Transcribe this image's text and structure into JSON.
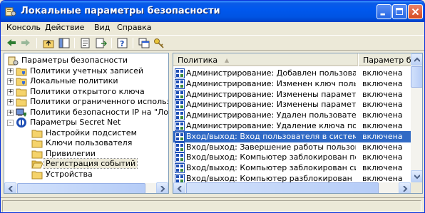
{
  "window": {
    "title": "Локальные параметры безопасности"
  },
  "menu": [
    "Консоль",
    "Действие",
    "Вид",
    "Справка"
  ],
  "tree": [
    {
      "label": "Параметры безопасности",
      "level": 0,
      "icon": "security-settings-icon",
      "expander": ""
    },
    {
      "label": "Политики учетных записей",
      "level": 1,
      "icon": "folder-shield-icon",
      "expander": "+"
    },
    {
      "label": "Локальные политики",
      "level": 1,
      "icon": "folder-shield-icon",
      "expander": "+"
    },
    {
      "label": "Политики открытого ключа",
      "level": 1,
      "icon": "folder-icon",
      "expander": "+"
    },
    {
      "label": "Политики ограниченного использования программ",
      "level": 1,
      "icon": "folder-icon",
      "expander": "+"
    },
    {
      "label": "Политики безопасности IP на \"Локальный компьютер\"",
      "level": 1,
      "icon": "ip-security-icon",
      "expander": "+"
    },
    {
      "label": "Параметры Secret Net",
      "level": 1,
      "icon": "secret-net-icon",
      "expander": "-"
    },
    {
      "label": "Настройки подсистем",
      "level": 2,
      "icon": "folder-icon",
      "expander": ""
    },
    {
      "label": "Ключи пользователя",
      "level": 2,
      "icon": "folder-icon",
      "expander": ""
    },
    {
      "label": "Привилегии",
      "level": 2,
      "icon": "folder-icon",
      "expander": ""
    },
    {
      "label": "Регистрация событий",
      "level": 2,
      "icon": "folder-open-icon",
      "expander": "",
      "selected": true
    },
    {
      "label": "Устройства",
      "level": 2,
      "icon": "folder-icon",
      "expander": ""
    }
  ],
  "list": {
    "columns": [
      "Политика",
      "Параметр без"
    ],
    "rows": [
      {
        "name": "Администрирование: Добавлен пользователь",
        "value": "включена"
      },
      {
        "name": "Администрирование: Изменен ключ пользоват...",
        "value": "включена"
      },
      {
        "name": "Администрирование: Изменены параметры де...",
        "value": "включена"
      },
      {
        "name": "Администрирование: Изменены параметры пол...",
        "value": "включена"
      },
      {
        "name": "Администрирование: Удален пользователь",
        "value": "включена"
      },
      {
        "name": "Администрирование: Удаление ключа пользов...",
        "value": "включена"
      },
      {
        "name": "Вход/выход: Вход пользователя в систему",
        "value": "включена",
        "selected": true
      },
      {
        "name": "Вход/выход: Завершение работы пользователя",
        "value": "включена"
      },
      {
        "name": "Вход/выход: Компьютер заблокирован пользо...",
        "value": "включена"
      },
      {
        "name": "Вход/выход: Компьютер заблокирован систем...",
        "value": "включена"
      },
      {
        "name": "Вход/выход: Компьютер разблокирован",
        "value": "включена"
      }
    ]
  },
  "colors": {
    "titlebar": "#0054E3",
    "selection": "#316AC5"
  }
}
